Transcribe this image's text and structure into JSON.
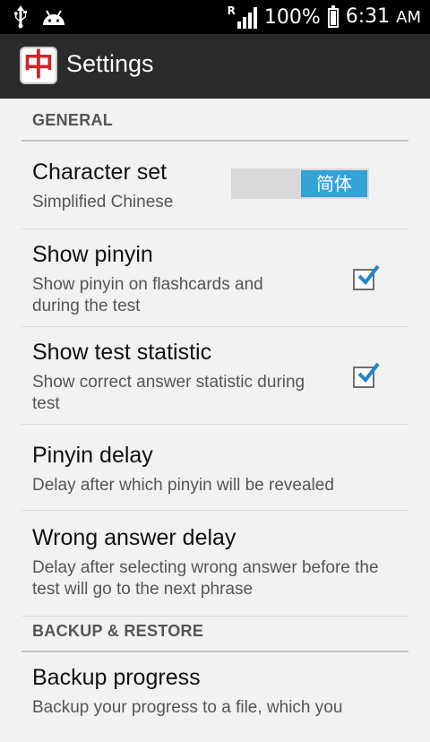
{
  "status_bar": {
    "left_icons": [
      "usb-icon",
      "android-icon"
    ],
    "roaming_mark": "R",
    "battery_text": "100%",
    "time": "6:31",
    "ampm": "AM"
  },
  "action_bar": {
    "app_icon_glyph": "中",
    "title": "Settings"
  },
  "sections": {
    "general": "GENERAL",
    "backup": "BACKUP & RESTORE"
  },
  "prefs": {
    "character_set": {
      "title": "Character set",
      "summary": "Simplified Chinese",
      "switch_value": "简体"
    },
    "show_pinyin": {
      "title": "Show pinyin",
      "summary": "Show pinyin on flashcards and during the test",
      "checked": true
    },
    "show_test_statistic": {
      "title": "Show test statistic",
      "summary": "Show correct answer statistic during test",
      "checked": true
    },
    "pinyin_delay": {
      "title": "Pinyin delay",
      "summary": "Delay after which pinyin will be revealed"
    },
    "wrong_answer_delay": {
      "title": "Wrong answer delay",
      "summary": "Delay after selecting wrong answer before the test will go to the next phrase"
    },
    "backup_progress": {
      "title": "Backup progress",
      "summary": "Backup your progress to a file, which you"
    }
  },
  "colors": {
    "accent": "#33a3d6",
    "action_bar": "#2a2a2a",
    "background": "#f2f2f2",
    "checkmark": "#1e88c9"
  }
}
